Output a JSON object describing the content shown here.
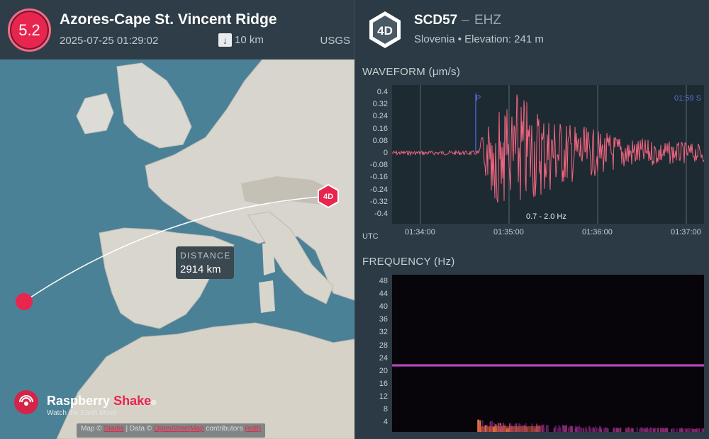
{
  "event": {
    "magnitude": "5.2",
    "title": "Azores-Cape St. Vincent Ridge",
    "datetime": "2025-07-25 01:29:02",
    "depth_icon": "arrow-down-icon",
    "depth": "10 km",
    "agency": "USGS"
  },
  "map": {
    "distance_label": "DISTANCE",
    "distance_value": "2914 km",
    "station_marker": "4D",
    "brand_name_1": "Raspberry",
    "brand_name_2": "Shake",
    "brand_mark": "®",
    "brand_tagline": "Watch the Earth Move",
    "attrib_prefix": "Map ©",
    "attrib_link1": "Stadia",
    "attrib_mid": "| Data ©",
    "attrib_link2": "OpenStreetMap",
    "attrib_suffix": "contributors",
    "attrib_link3": "(edit)"
  },
  "station": {
    "network_badge": "4D",
    "code": "SCD57",
    "dash": "–",
    "channel": "EHZ",
    "info": "Slovenia • Elevation: 241 m"
  },
  "waveform": {
    "title": "WAVEFORM",
    "unit": "(μm/s)",
    "yticks": [
      "0.4",
      "0.32",
      "0.24",
      "0.16",
      "0.08",
      "0",
      "-0.08",
      "-0.16",
      "-0.24",
      "-0.32",
      "-0.4"
    ],
    "xtick_axis": "UTC",
    "xticks": [
      "01:34:00",
      "01:35:00",
      "01:36:00",
      "01:37:00"
    ],
    "p_label": "P",
    "end_label": "01:59 S",
    "band": "0.7 - 2.0 Hz",
    "color": "#f26680"
  },
  "frequency": {
    "title": "FREQUENCY",
    "unit": "(Hz)",
    "yticks": [
      "48",
      "44",
      "40",
      "36",
      "32",
      "28",
      "24",
      "20",
      "16",
      "12",
      "8",
      "4"
    ]
  },
  "colors": {
    "accent": "#e8254f",
    "panel": "#2e3d47",
    "plot_bg": "#1d2a32"
  }
}
